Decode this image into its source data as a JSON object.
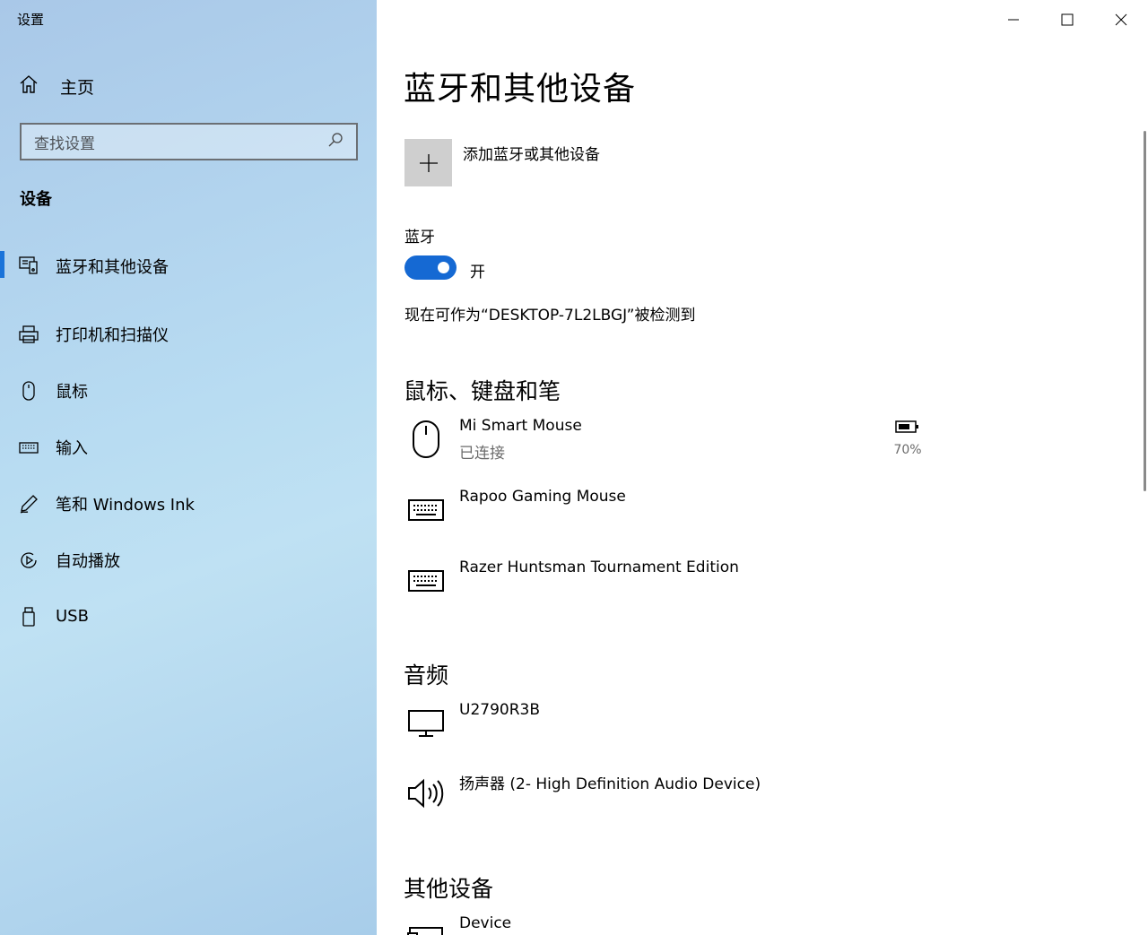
{
  "window": {
    "title": "设置"
  },
  "sidebar": {
    "home_label": "主页",
    "search_placeholder": "查找设置",
    "section_label": "设备",
    "items": [
      {
        "label": "蓝牙和其他设备",
        "icon": "bluetooth-devices-icon",
        "active": true
      },
      {
        "label": "打印机和扫描仪",
        "icon": "printer-icon"
      },
      {
        "label": "鼠标",
        "icon": "mouse-icon"
      },
      {
        "label": "输入",
        "icon": "keyboard-icon"
      },
      {
        "label": "笔和 Windows Ink",
        "icon": "pen-icon"
      },
      {
        "label": "自动播放",
        "icon": "autoplay-icon"
      },
      {
        "label": "USB",
        "icon": "usb-icon"
      }
    ]
  },
  "main": {
    "title": "蓝牙和其他设备",
    "add_device_label": "添加蓝牙或其他设备",
    "bluetooth": {
      "label": "蓝牙",
      "state_label": "开",
      "on": true,
      "discoverable_text": "现在可作为“DESKTOP-7L2LBGJ”被检测到"
    },
    "sections": {
      "input": {
        "title": "鼠标、键盘和笔",
        "devices": [
          {
            "name": "Mi Smart Mouse",
            "status": "已连接",
            "icon": "mouse-icon",
            "battery": "70%"
          },
          {
            "name": "Rapoo Gaming Mouse",
            "icon": "keyboard-icon"
          },
          {
            "name": "Razer Huntsman Tournament Edition",
            "icon": "keyboard-icon"
          }
        ]
      },
      "audio": {
        "title": "音频",
        "devices": [
          {
            "name": "U2790R3B",
            "icon": "monitor-icon"
          },
          {
            "name": "扬声器 (2- High Definition Audio Device)",
            "icon": "speaker-icon"
          }
        ]
      },
      "other": {
        "title": "其他设备",
        "devices": [
          {
            "name": "Device",
            "icon": "device-icon"
          }
        ]
      }
    }
  },
  "colors": {
    "accent": "#1569d3",
    "add_tile": "#cfcfcf"
  }
}
